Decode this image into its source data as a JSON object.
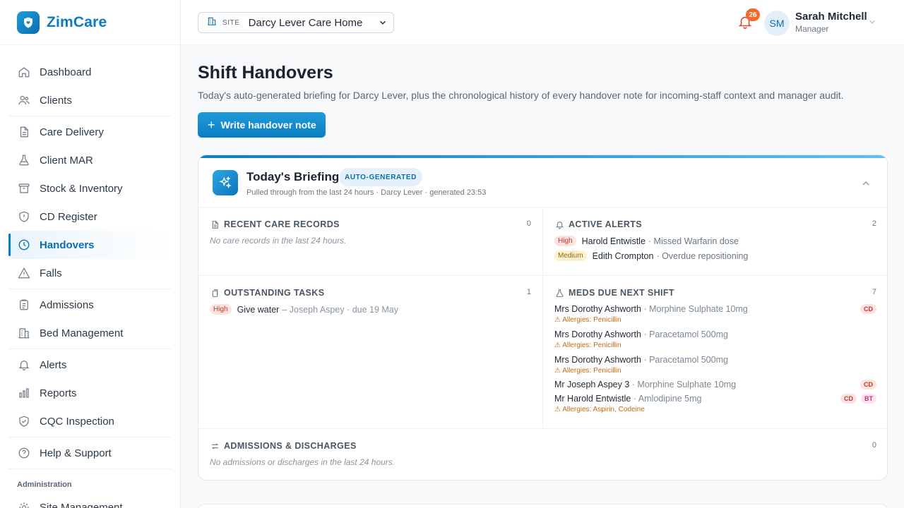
{
  "brand": {
    "name": "ZimCare"
  },
  "nav": {
    "dashboard": "Dashboard",
    "clients": "Clients",
    "care_delivery": "Care Delivery",
    "client_mar": "Client MAR",
    "stock": "Stock & Inventory",
    "cd_register": "CD Register",
    "handovers": "Handovers",
    "falls": "Falls",
    "admissions": "Admissions",
    "bed_management": "Bed Management",
    "alerts": "Alerts",
    "reports": "Reports",
    "cqc": "CQC Inspection",
    "help": "Help & Support",
    "admin_section": "Administration",
    "site_management": "Site Management"
  },
  "topbar": {
    "site_tag": "SITE",
    "site_name": "Darcy Lever Care Home",
    "notification_count": "26",
    "user_initials": "SM",
    "user_name": "Sarah Mitchell",
    "user_role": "Manager"
  },
  "page": {
    "title": "Shift Handovers",
    "description": "Today's auto-generated briefing for Darcy Lever, plus the chronological history of every handover note for incoming-staff context and manager audit.",
    "write_button": "Write handover note"
  },
  "briefing": {
    "title": "Today's Briefing",
    "badge": "AUTO-GENERATED",
    "subtitle": "Pulled through from the last 24 hours · Darcy Lever · generated 23:53",
    "recent_care": {
      "title": "RECENT CARE RECORDS",
      "count": "0",
      "empty": "No care records in the last 24 hours."
    },
    "active_alerts": {
      "title": "ACTIVE ALERTS",
      "count": "2",
      "items": [
        {
          "severity": "High",
          "name": "Harold Entwistle",
          "detail": "· Missed Warfarin dose"
        },
        {
          "severity": "Medium",
          "name": "Edith Crompton",
          "detail": "· Overdue repositioning"
        }
      ]
    },
    "outstanding_tasks": {
      "title": "OUTSTANDING TASKS",
      "count": "1",
      "items": [
        {
          "priority": "High",
          "task": "Give water",
          "detail": "– Joseph Aspey · due 19 May"
        }
      ]
    },
    "meds_due": {
      "title": "MEDS DUE NEXT SHIFT",
      "count": "7",
      "items": [
        {
          "client": "Mrs Dorothy Ashworth",
          "drug": "· Morphine Sulphate 10mg",
          "allergy": "⚠ Allergies: Penicillin",
          "tag1": "CD",
          "tag2": ""
        },
        {
          "client": "Mrs Dorothy Ashworth",
          "drug": "· Paracetamol 500mg",
          "allergy": "⚠ Allergies: Penicillin",
          "tag1": "",
          "tag2": ""
        },
        {
          "client": "Mrs Dorothy Ashworth",
          "drug": "· Paracetamol 500mg",
          "allergy": "⚠ Allergies: Penicillin",
          "tag1": "",
          "tag2": ""
        },
        {
          "client": "Mr Joseph Aspey 3",
          "drug": "· Morphine Sulphate 10mg",
          "allergy": "",
          "tag1": "CD",
          "tag2": ""
        },
        {
          "client": "Mr Harold Entwistle",
          "drug": "· Amlodipine 5mg",
          "allergy": "⚠ Allergies: Aspirin, Codeine",
          "tag1": "CD",
          "tag2": "BT"
        }
      ]
    },
    "admissions": {
      "title": "ADMISSIONS & DISCHARGES",
      "count": "0",
      "empty": "No admissions or discharges in the last 24 hours."
    }
  }
}
